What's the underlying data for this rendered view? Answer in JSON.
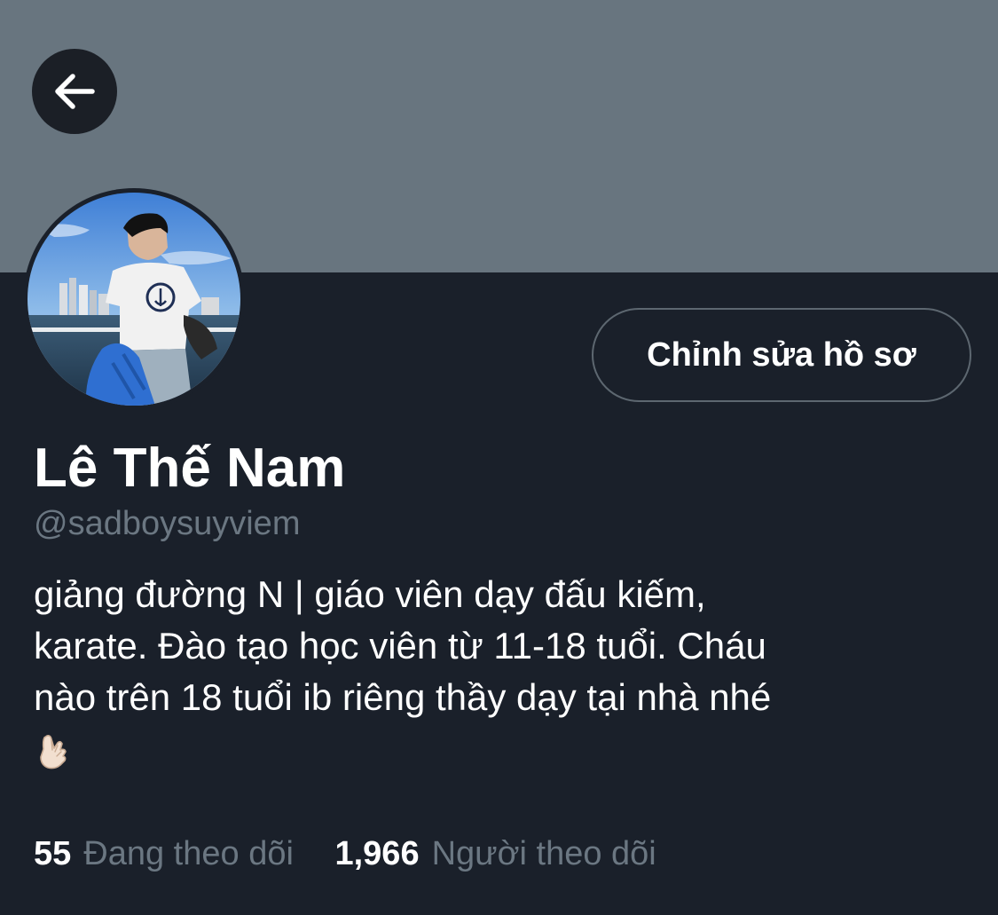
{
  "header": {
    "back_icon": "arrow-left-icon",
    "banner_color": "#68757f"
  },
  "profile": {
    "avatar_icon": "profile-photo",
    "edit_label": "Chỉnh sửa hồ sơ",
    "name": "Lê Thế Nam",
    "handle": "@sadboysuyviem",
    "bio_lines": [
      "giảng đường N | giáo viên dạy đấu kiếm,",
      "karate. Đào tạo học viên từ 11-18 tuổi. Cháu",
      "nào trên 18 tuổi ib riêng thầy dạy tại nhà nhé"
    ],
    "bio_emoji_icon": "hand-emoji-icon"
  },
  "stats": {
    "following_count": "55",
    "following_label": "Đang theo dõi",
    "followers_count": "1,966",
    "followers_label": "Người theo dõi"
  },
  "colors": {
    "background": "#1a202a",
    "secondary_text": "#6b7782",
    "button_border": "#5d6770"
  }
}
